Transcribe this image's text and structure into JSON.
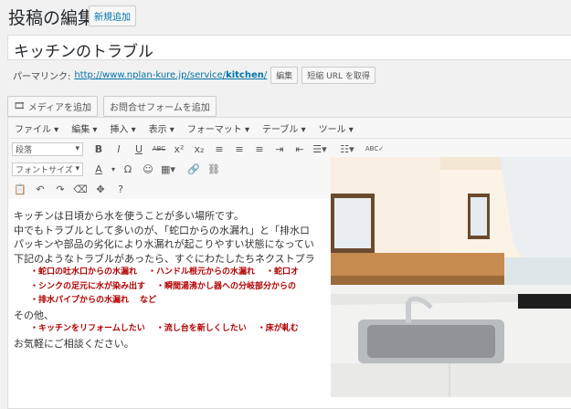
{
  "header": {
    "title": "投稿の編集",
    "add_new": "新規追加"
  },
  "post": {
    "title": "キッチンのトラブル"
  },
  "permalink": {
    "label": "パーマリンク:",
    "url_base": "http://www.nplan-kure.jp/service/",
    "slug": "kitchen",
    "url_end": "/",
    "edit": "編集",
    "short_url": "短縮 URL を取得"
  },
  "media": {
    "add_media": "メディアを追加",
    "add_form": "お問合せフォームを追加"
  },
  "menubar": [
    "ファイル ▾",
    "編集 ▾",
    "挿入 ▾",
    "表示 ▾",
    "フォーマット ▾",
    "テーブル ▾",
    "ツール ▾"
  ],
  "toolbar": {
    "format_select": "段落",
    "font_size_select": "フォントサイズ"
  },
  "content": {
    "line1": "キッチンは日頃から水を使うことが多い場所です。",
    "line2": "中でもトラブルとして多いのが、「蛇口からの水漏れ」と「排水ロ",
    "line3": "パッキンや部品の劣化により水漏れが起こりやすい状態になってい",
    "line4": "下記のようなトラブルがあったら、すぐにわたしたちネクストプラ",
    "red1": [
      "・蛇口の吐水口からの水漏れ",
      "・ハンドル根元からの水漏れ",
      "・蛇口オ"
    ],
    "red2": [
      "・シンクの足元に水が染み出す",
      "・瞬間湯沸かし器への分岐部分からの"
    ],
    "red3": [
      "・排水パイプからの水漏れ",
      "など"
    ],
    "line5": "その他、",
    "red4": [
      "・キッチンをリフォームしたい",
      "・流し台を新しくしたい",
      "・床が軋む"
    ],
    "line6": "お気軽にご相談ください。"
  }
}
